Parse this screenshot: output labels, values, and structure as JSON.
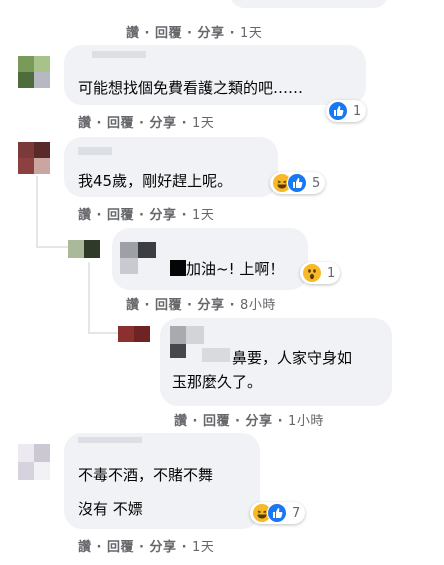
{
  "comments": [
    {
      "text_lines": [
        ""
      ],
      "actions": {
        "like": "讚",
        "reply": "回覆",
        "share": "分享",
        "time": "1天"
      }
    },
    {
      "text_lines": [
        "可能想找個免費看護之類的吧……"
      ],
      "reaction_count": "1",
      "reaction_icons": [
        "like-icon"
      ],
      "actions": {
        "like": "讚",
        "reply": "回覆",
        "share": "分享",
        "time": "1天"
      }
    },
    {
      "text_lines": [
        "我45歲，剛好趕上呢。"
      ],
      "reaction_count": "5",
      "reaction_icons": [
        "haha-icon",
        "like-icon"
      ],
      "actions": {
        "like": "讚",
        "reply": "回覆",
        "share": "分享",
        "time": "1天"
      }
    },
    {
      "text_lines": [
        "加油~! 上啊！"
      ],
      "reaction_count": "1",
      "reaction_icons": [
        "wow-icon"
      ],
      "actions": {
        "like": "讚",
        "reply": "回覆",
        "share": "分享",
        "time": "8小時"
      }
    },
    {
      "text_lines": [
        "鼻要，人家守身如",
        "玉那麼久了。"
      ],
      "actions": {
        "like": "讚",
        "reply": "回覆",
        "share": "分享",
        "time": "1小時"
      }
    },
    {
      "text_lines": [
        "不毒不酒，不賭不舞",
        "沒有 不嫖"
      ],
      "reaction_count": "7",
      "reaction_icons": [
        "haha-icon",
        "like-icon"
      ],
      "actions": {
        "like": "讚",
        "reply": "回覆",
        "share": "分享",
        "time": "1天"
      }
    }
  ],
  "colors": {
    "bubble": "#f0f2f5",
    "like_blue": "#1877f2",
    "haha_yellow": "#f7b928",
    "meta_gray": "#65676b"
  }
}
